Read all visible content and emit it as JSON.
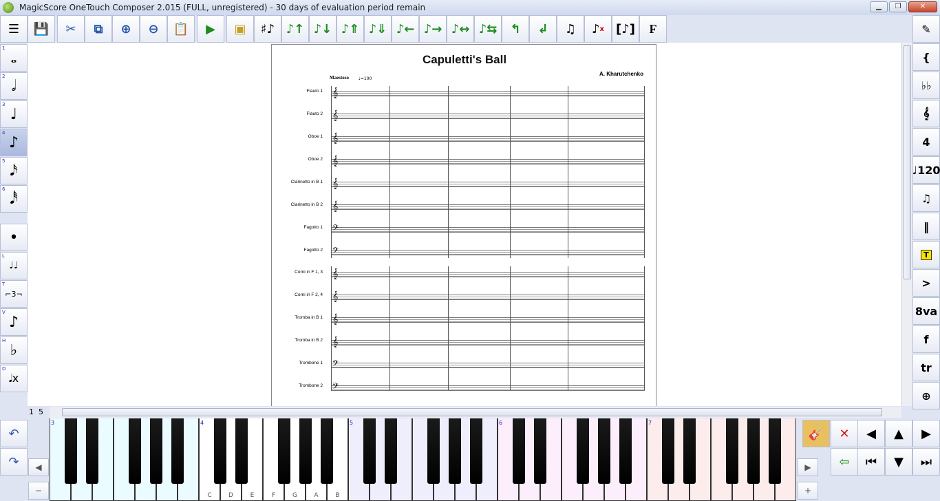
{
  "window": {
    "title": "MagicScore OneTouch Composer 2.015 (FULL, unregistered) - 30 days of evaluation period remain"
  },
  "toolbar": {
    "icons": [
      "menu-icon",
      "save-icon",
      "cut-icon",
      "copy-icon",
      "zoom-in-icon",
      "zoom-out-icon",
      "paste-icon",
      "play-icon",
      "record-icon",
      "accidental-icon",
      "note-up-icon",
      "note-down-icon",
      "octave-up-icon",
      "octave-down-icon",
      "move-left-icon",
      "move-right-icon",
      "expand-icon",
      "shrink-icon",
      "tie-up-icon",
      "tie-down-icon",
      "beam-icon",
      "delete-note-icon",
      "grace-note-icon",
      "font-icon"
    ],
    "font_label": "F"
  },
  "left_palette": {
    "items": [
      {
        "num": "1",
        "glyph": "𝅝",
        "name": "whole-note"
      },
      {
        "num": "2",
        "glyph": "𝅗𝅥",
        "name": "half-note"
      },
      {
        "num": "3",
        "glyph": "♩",
        "name": "quarter-note"
      },
      {
        "num": "4",
        "glyph": "♪",
        "name": "eighth-note",
        "selected": true
      },
      {
        "num": "5",
        "glyph": "𝅘𝅥𝅯",
        "name": "sixteenth-note"
      },
      {
        "num": "6",
        "glyph": "𝅘𝅥𝅰",
        "name": "thirtysecond-note"
      },
      {
        "num": "",
        "glyph": "•",
        "name": "dot"
      },
      {
        "num": "L",
        "glyph": "♩♩",
        "name": "tie"
      },
      {
        "num": "T",
        "glyph": "⌐3¬",
        "name": "triplet"
      },
      {
        "num": "V",
        "glyph": "♪",
        "name": "grace"
      },
      {
        "num": "H",
        "glyph": "♭",
        "name": "flat"
      },
      {
        "num": "D",
        "glyph": "𝅘𝅥x",
        "name": "delete"
      }
    ]
  },
  "right_palette": {
    "items": [
      "pencil-icon",
      "brace-icon",
      "key-signature-icon",
      "clef-icon",
      "time-signature-icon",
      "tempo-icon",
      "tuplet-icon",
      "barline-icon",
      "text-icon",
      "accent-icon",
      "ottava-icon",
      "dynamics-icon",
      "trill-icon",
      "coda-icon"
    ],
    "tempo_label": "120",
    "ottava_label": "8va",
    "text_label": "T",
    "dynamics_label": "f",
    "trill_label": "tr"
  },
  "score": {
    "title": "Capuletti's Ball",
    "composer": "A. Kharutchenko",
    "tempo": "Maestoso",
    "tempo_mark": "♩=100",
    "instruments": [
      "Flauto 1",
      "Flauto 2",
      "Oboe 1",
      "Oboe 2",
      "Clarinetto in B 1",
      "Clarinetto in B 2",
      "Fagotto 1",
      "Fagotto 2",
      "Corni in F 1, 3",
      "Corni in F 2, 4",
      "Tromba in B 1",
      "Tromba in B 2",
      "Trombone 1",
      "Trombone 2"
    ]
  },
  "status": {
    "page_current": "1",
    "page_total": "5"
  },
  "piano": {
    "octaves": [
      "3",
      "4",
      "5",
      "6",
      "7"
    ],
    "labels": [
      "C",
      "D",
      "E",
      "F",
      "G",
      "A",
      "B"
    ]
  },
  "bottom_right": {
    "icons": [
      "guitar-icon",
      "cancel-icon",
      "left-arrow-icon",
      "up-arrow-icon",
      "right-arrow-icon",
      "enter-icon",
      "first-icon",
      "down-arrow-icon",
      "last-icon"
    ]
  }
}
